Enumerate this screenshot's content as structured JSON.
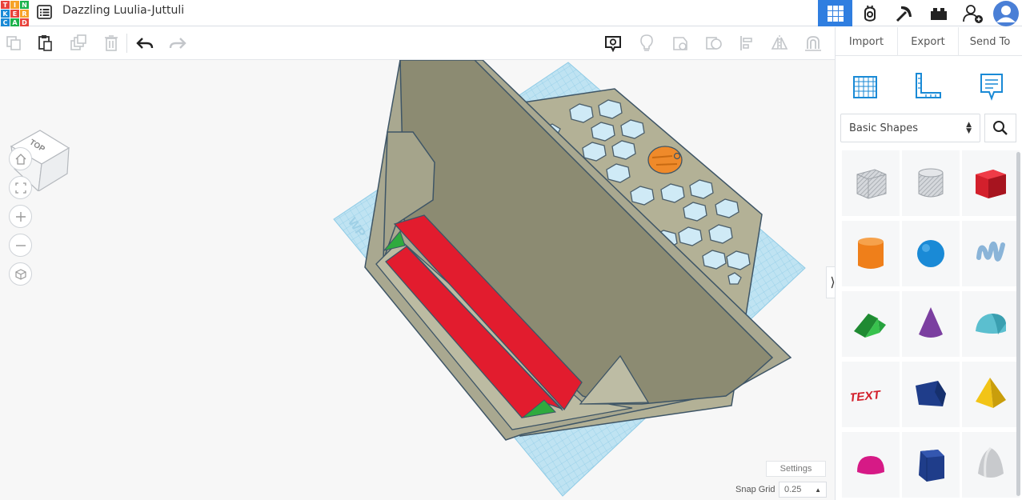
{
  "app": {
    "logo_letters": [
      "T",
      "I",
      "N",
      "K",
      "E",
      "R",
      "C",
      "A",
      "D"
    ],
    "logo_colors": [
      "#e8423a",
      "#f7a227",
      "#1bb24b",
      "#1a8ad6",
      "#e8423a",
      "#f7a227",
      "#1a8ad6",
      "#1bb24b",
      "#e8423a"
    ],
    "title": "Dazzling Luulia-Juttuli"
  },
  "view_tabs": [
    {
      "name": "3d-design-grid-icon",
      "active": true
    },
    {
      "name": "codeblocks-icon",
      "active": false
    },
    {
      "name": "minecraft-pickaxe-icon",
      "active": false
    },
    {
      "name": "lego-brick-icon",
      "active": false
    },
    {
      "name": "invite-user-icon",
      "active": false
    }
  ],
  "toolbar": {
    "copy": "copy-icon",
    "paste": "paste-icon",
    "duplicate": "duplicate-icon",
    "delete": "trash-icon",
    "undo": "undo-icon",
    "redo": "redo-icon",
    "notes": "notes-icon",
    "light": "light-bulb-icon",
    "group": "group-icon",
    "ungroup": "ungroup-icon",
    "align": "align-icon",
    "mirror": "mirror-icon",
    "cruise": "cruise-icon"
  },
  "panel": {
    "import_label": "Import",
    "export_label": "Export",
    "send_to_label": "Send To",
    "tools": [
      "workplane-icon",
      "ruler-icon",
      "notes-tool-icon"
    ],
    "shape_library": "Basic Shapes",
    "shapes": [
      {
        "name": "box-hole",
        "color": "#b8bcc2"
      },
      {
        "name": "cylinder-hole",
        "color": "#b8bcc2"
      },
      {
        "name": "box",
        "color": "#d3202c"
      },
      {
        "name": "cylinder",
        "color": "#ef7f1a"
      },
      {
        "name": "sphere",
        "color": "#1a8ad6"
      },
      {
        "name": "scribble",
        "color": "#8ab4d8"
      },
      {
        "name": "roof",
        "color": "#27a33e"
      },
      {
        "name": "cone",
        "color": "#7b3fa0"
      },
      {
        "name": "round-roof",
        "color": "#5bbfcf"
      },
      {
        "name": "text",
        "color": "#d3202c"
      },
      {
        "name": "polygon",
        "color": "#1f3d8a"
      },
      {
        "name": "pyramid",
        "color": "#f2c417"
      },
      {
        "name": "half-sphere",
        "color": "#d61a86"
      },
      {
        "name": "hexagonal-prism",
        "color": "#1f3d8a"
      },
      {
        "name": "paraboloid",
        "color": "#c8cacd"
      }
    ]
  },
  "canvas": {
    "viewcube_label": "TOP",
    "workplane_label": "WP",
    "settings_label": "Settings",
    "snap_grid_label": "Snap Grid",
    "snap_grid_value": "0.25"
  }
}
